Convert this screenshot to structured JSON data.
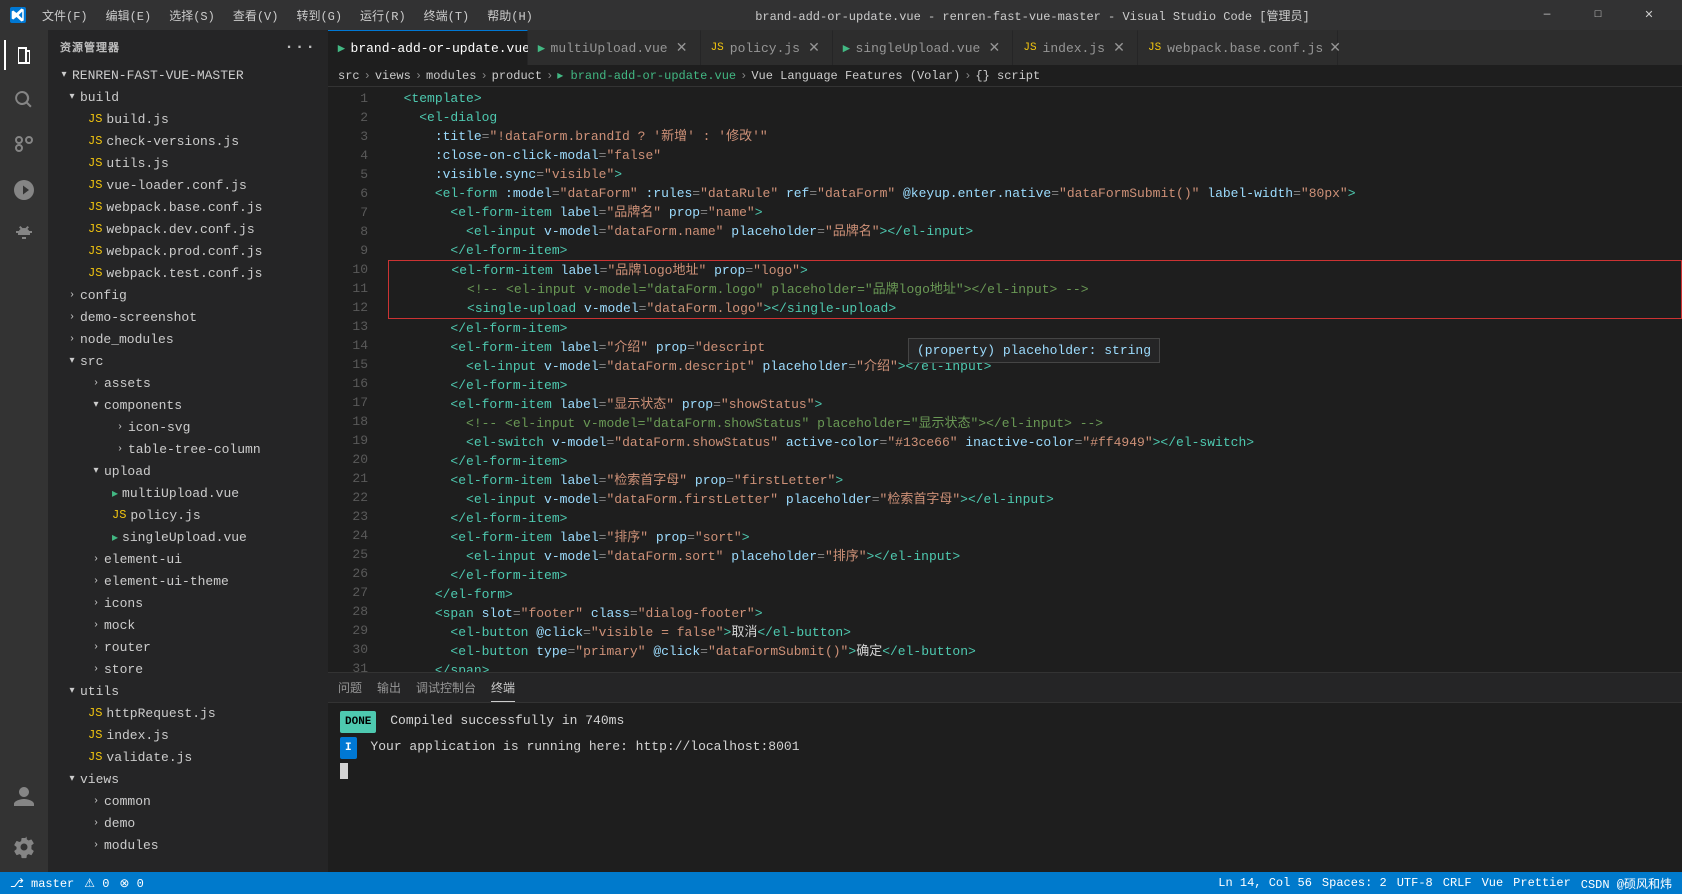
{
  "titleBar": {
    "title": "brand-add-or-update.vue - renren-fast-vue-master - Visual Studio Code [管理员]",
    "menuItems": [
      "文件(F)",
      "编辑(E)",
      "选择(S)",
      "查看(V)",
      "转到(G)",
      "运行(R)",
      "终端(T)",
      "帮助(H)"
    ]
  },
  "sidebar": {
    "header": "资源管理器",
    "dotsLabel": "···",
    "rootLabel": "RENREN-FAST-VUE-MASTER",
    "tree": {
      "build": {
        "label": "build",
        "collapsed": false,
        "children": [
          "build.js",
          "check-versions.js",
          "utils.js",
          "vue-loader.conf.js",
          "webpack.base.conf.js",
          "webpack.dev.conf.js",
          "webpack.prod.conf.js",
          "webpack.test.conf.js"
        ]
      },
      "config": "config",
      "demoScreenshot": "demo-screenshot",
      "nodeModules": "node_modules",
      "src": {
        "label": "src",
        "children": {
          "assets": "assets",
          "components": {
            "label": "components",
            "children": [
              "icon-svg",
              "table-tree-column"
            ]
          },
          "upload": {
            "label": "upload",
            "children": [
              "multiUpload.vue",
              "policy.js",
              "singleUpload.vue"
            ]
          },
          "elementUi": "element-ui",
          "elementUiTheme": "element-ui-theme",
          "icons": "icons",
          "mock": "mock",
          "router": "router",
          "store": "store"
        }
      },
      "utils": {
        "label": "utils",
        "children": [
          "httpRequest.js",
          "index.js",
          "validate.js"
        ]
      },
      "views": {
        "label": "views",
        "children": [
          "common",
          "demo",
          "modules"
        ]
      }
    }
  },
  "tabs": [
    {
      "label": "brand-add-or-update.vue",
      "type": "vue",
      "active": true
    },
    {
      "label": "multiUpload.vue",
      "type": "vue",
      "active": false
    },
    {
      "label": "policy.js",
      "type": "js",
      "active": false
    },
    {
      "label": "singleUpload.vue",
      "type": "vue",
      "active": false
    },
    {
      "label": "index.js",
      "type": "js",
      "active": false
    },
    {
      "label": "webpack.base.conf.js",
      "type": "js",
      "active": false
    }
  ],
  "breadcrumb": [
    "src",
    ">",
    "views",
    ">",
    "modules",
    ">",
    "product",
    ">",
    "brand-add-or-update.vue",
    ">",
    "Vue Language Features (Volar)",
    ">",
    "{}",
    "script"
  ],
  "codeLines": [
    {
      "num": 1,
      "content": "  <template>"
    },
    {
      "num": 2,
      "content": "    <el-dialog"
    },
    {
      "num": 3,
      "content": "      :title=\"!dataForm.brandId ? '新增' : '修改'\""
    },
    {
      "num": 4,
      "content": "      :close-on-click-modal=\"false\""
    },
    {
      "num": 5,
      "content": "      :visible.sync=\"visible\">"
    },
    {
      "num": 6,
      "content": "      <el-form :model=\"dataForm\" :rules=\"dataRule\" ref=\"dataForm\" @keyup.enter.native=\"dataFormSubmit()\" label-width=\"80px\">"
    },
    {
      "num": 7,
      "content": "        <el-form-item label=\"品牌名\" prop=\"name\">"
    },
    {
      "num": 8,
      "content": "          <el-input v-model=\"dataForm.name\" placeholder=\"品牌名\"></el-input>"
    },
    {
      "num": 9,
      "content": "        </el-form-item>"
    },
    {
      "num": 10,
      "content": "        <el-form-item label=\"品牌logo地址\" prop=\"logo\">"
    },
    {
      "num": 11,
      "content": "          <!-- <el-input v-model=\"dataForm.logo\" placeholder=\"品牌logo地址\"></el-input> -->"
    },
    {
      "num": 12,
      "content": "          <single-upload v-model=\"dataForm.logo\"></single-upload>"
    },
    {
      "num": 13,
      "content": "        </el-form-item>"
    },
    {
      "num": 14,
      "content": "        <el-form-item label=\"介绍\" prop=\"descript      (property) placeholder: string"
    },
    {
      "num": 15,
      "content": "          <el-input v-model=\"dataForm.descript\" placeholder=\"介绍\"></el-input>"
    },
    {
      "num": 16,
      "content": "        </el-form-item>"
    },
    {
      "num": 17,
      "content": "        <el-form-item label=\"显示状态\" prop=\"showStatus\">"
    },
    {
      "num": 18,
      "content": "          <!-- <el-input v-model=\"dataForm.showStatus\" placeholder=\"显示状态\"></el-input> -->"
    },
    {
      "num": 19,
      "content": "          <el-switch v-model=\"dataForm.showStatus\" active-color=\"#13ce66\" inactive-color=\"#ff4949\"></el-switch>"
    },
    {
      "num": 20,
      "content": "        </el-form-item>"
    },
    {
      "num": 21,
      "content": "        <el-form-item label=\"检索首字母\" prop=\"firstLetter\">"
    },
    {
      "num": 22,
      "content": "          <el-input v-model=\"dataForm.firstLetter\" placeholder=\"检索首字母\"></el-input>"
    },
    {
      "num": 23,
      "content": "        </el-form-item>"
    },
    {
      "num": 24,
      "content": "        <el-form-item label=\"排序\" prop=\"sort\">"
    },
    {
      "num": 25,
      "content": "          <el-input v-model=\"dataForm.sort\" placeholder=\"排序\"></el-input>"
    },
    {
      "num": 26,
      "content": "        </el-form-item>"
    },
    {
      "num": 27,
      "content": "      </el-form>"
    },
    {
      "num": 28,
      "content": "      <span slot=\"footer\" class=\"dialog-footer\">"
    },
    {
      "num": 29,
      "content": "        <el-button @click=\"visible = false\">取消</el-button>"
    },
    {
      "num": 30,
      "content": "        <el-button type=\"primary\" @click=\"dataFormSubmit()\">确定</el-button>"
    },
    {
      "num": 31,
      "content": "      </span>"
    }
  ],
  "tooltip": {
    "text": "(property) placeholder: string",
    "visible": true
  },
  "panel": {
    "tabs": [
      "问题",
      "输出",
      "调试控制台",
      "终端"
    ],
    "activeTab": "终端",
    "lines": [
      {
        "type": "done",
        "badge": "DONE",
        "text": "Compiled successfully in 740ms"
      },
      {
        "type": "info",
        "badge": "I",
        "text": "Your application is running here: http://localhost:8001"
      }
    ]
  },
  "statusBar": {
    "left": [
      "⎇ master",
      "⚠ 0",
      "⊗ 0"
    ],
    "right": [
      "Ln 14, Col 56",
      "Spaces: 2",
      "UTF-8",
      "CRLF",
      "Vue",
      "Prettier",
      "CSDN @硕风和炜"
    ]
  }
}
